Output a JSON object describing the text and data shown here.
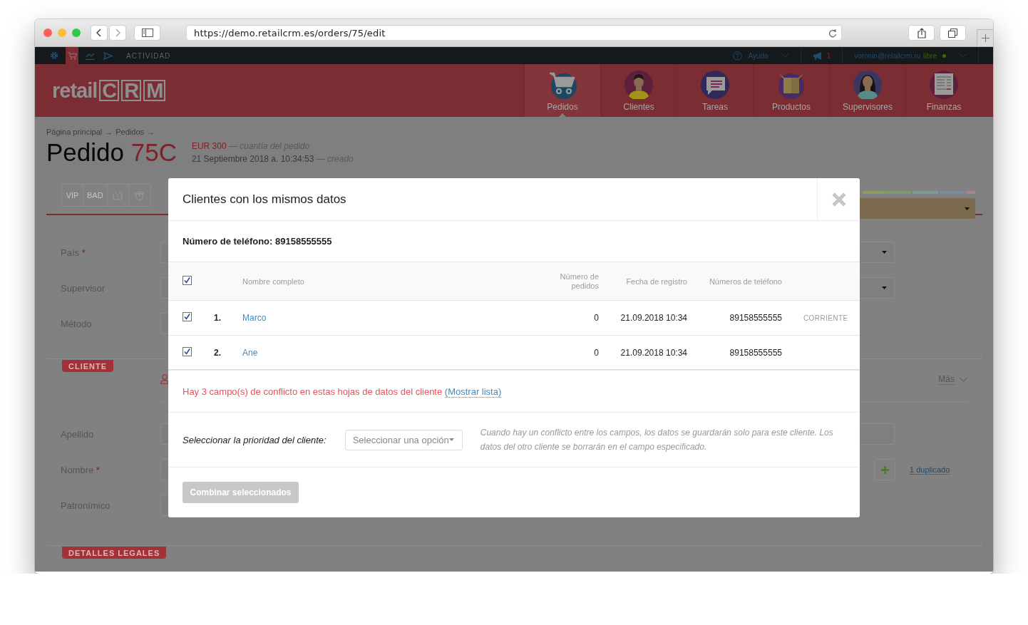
{
  "browser": {
    "url": "https://demo.retailcrm.es/orders/75/edit"
  },
  "topbar": {
    "icons": [
      {
        "kind": "gear",
        "selected": false
      },
      {
        "kind": "cart",
        "selected": true
      },
      {
        "kind": "chart",
        "selected": false
      },
      {
        "kind": "send",
        "selected": false
      }
    ],
    "section": "ACTIVIDAD",
    "help": "Ayuda",
    "notifications": "1",
    "user_email": "voronin@retailcrm.ru",
    "user_status": "libre"
  },
  "header": {
    "logo": {
      "prefix": "retail",
      "letters": [
        "C",
        "R",
        "M"
      ]
    },
    "nav": [
      {
        "label": "Pedidos",
        "kind": "cart",
        "selected": true
      },
      {
        "label": "Clientes",
        "kind": "man",
        "selected": false
      },
      {
        "label": "Tareas",
        "kind": "chat",
        "selected": false
      },
      {
        "label": "Productos",
        "kind": "box",
        "selected": false
      },
      {
        "label": "Supervisores",
        "kind": "woman",
        "selected": false
      },
      {
        "label": "Finanzas",
        "kind": "document",
        "selected": false
      }
    ]
  },
  "breadcrumb": {
    "items": [
      "Página principal",
      "Pedidos"
    ],
    "separator": "→"
  },
  "order": {
    "title": "Pedido",
    "number": "75C",
    "amount": "EUR 300",
    "amount_note": "— cuantía del pedido",
    "created": "21 Septiembre 2018 a. 10:34:53",
    "created_note": "— creado"
  },
  "tags": [
    "VIP",
    "BAD"
  ],
  "form": {
    "fields": [
      {
        "label": "País",
        "required_mark": "*",
        "kind": "select"
      },
      {
        "label": "Supervisor",
        "kind": "select"
      },
      {
        "label": "Método",
        "kind": "short"
      }
    ]
  },
  "client": {
    "badge": "CLIENTE",
    "more": "Más",
    "fields": [
      {
        "label": "Apellido",
        "kind": "input"
      },
      {
        "label": "Nombre",
        "required_mark": "*",
        "kind": "input_add",
        "duplicates": "1 duplicado"
      },
      {
        "label": "Patronímico",
        "kind": "short"
      }
    ]
  },
  "legal": {
    "badge": "DETALLES LEGALES"
  },
  "modal": {
    "title": "Clientes con los mismos datos",
    "subtitle": "Número de teléfono: 89158555555",
    "all_checked": true,
    "columns": [
      "Nombre completo",
      "Número de pedidos",
      "Fecha de registro",
      "Números de teléfono"
    ],
    "rows": [
      {
        "checked": true,
        "index": "1.",
        "name": "Marco",
        "orders": "0",
        "registered": "21.09.2018 10:34",
        "phone": "89158555555",
        "tag": "CORRIENTE"
      },
      {
        "checked": true,
        "index": "2.",
        "name": "Ane",
        "orders": "0",
        "registered": "21.09.2018 10:34",
        "phone": "89158555555"
      }
    ],
    "conflict": {
      "text": "Hay 3 campo(s) de conflicto en estas hojas de datos del cliente",
      "link": "(Mostrar lista)"
    },
    "priority": {
      "label": "Seleccionar la prioridad del cliente:",
      "placeholder": "Seleccionar una opción",
      "hint": "Cuando hay un conflicto entre los campos, los datos se guardarán solo para este cliente. Los datos del otro cliente se borrarán en el campo especificado."
    },
    "button": {
      "label": "Combinar seleccionados",
      "disabled": true
    }
  }
}
